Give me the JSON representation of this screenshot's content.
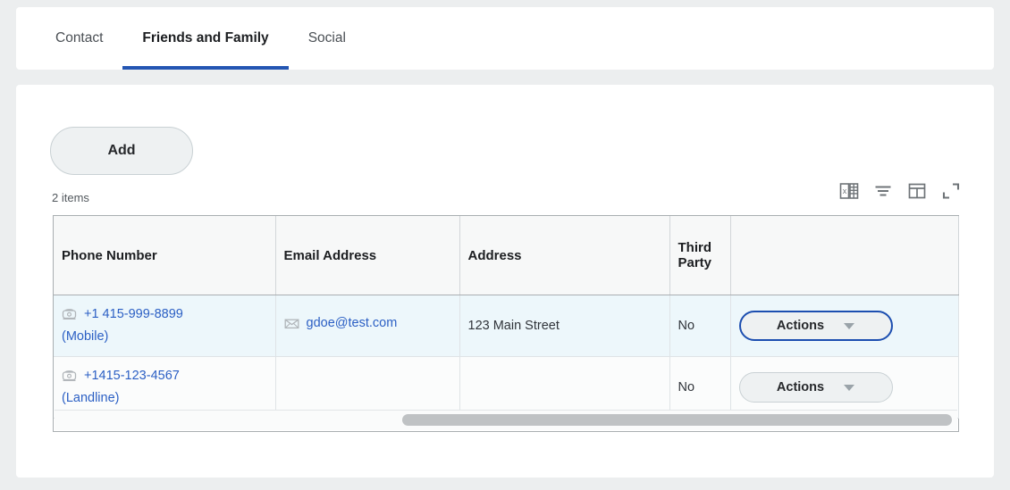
{
  "page": {
    "background_color": "#eceeef",
    "card_color": "#ffffff",
    "accent_color": "#2456b3",
    "link_color": "#2b5fc4",
    "selected_row_color": "#edf7fb"
  },
  "tabs": [
    {
      "label": "Contact",
      "active": false
    },
    {
      "label": "Friends and Family",
      "active": true
    },
    {
      "label": "Social",
      "active": false
    }
  ],
  "toolbar": {
    "add_label": "Add",
    "items_count": "2 items",
    "icons": [
      {
        "name": "export-to-excel-icon",
        "title": "Export to Excel"
      },
      {
        "name": "filter-icon",
        "title": "Filter"
      },
      {
        "name": "column-layout-icon",
        "title": "Toggle columns"
      },
      {
        "name": "expand-icon",
        "title": "Expand"
      }
    ]
  },
  "table": {
    "columns": [
      "Phone Number",
      "Email Address",
      "Address",
      "Third Party",
      ""
    ],
    "rows": [
      {
        "selected": true,
        "phone_number": "+1 415-999-8899",
        "phone_type": "(Mobile)",
        "email": "gdoe@test.com",
        "address": "123 Main Street",
        "third_party": "No",
        "actions_label": "Actions",
        "actions_focused": true
      },
      {
        "selected": false,
        "phone_number": "+1415-123-4567",
        "phone_type": "(Landline)",
        "email": "",
        "address": "",
        "third_party": "No",
        "actions_label": "Actions",
        "actions_focused": false
      }
    ]
  },
  "scrollbar": {
    "orientation": "horizontal",
    "thumb_left_pct": 38,
    "thumb_width_pct": 61
  }
}
